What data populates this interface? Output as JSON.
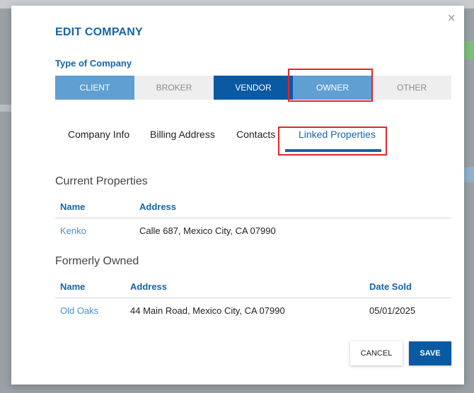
{
  "modal": {
    "title": "EDIT COMPANY",
    "close_glyph": "×"
  },
  "type_of_company": {
    "label": "Type of Company",
    "options": [
      "CLIENT",
      "BROKER",
      "VENDOR",
      "OWNER",
      "OTHER"
    ]
  },
  "tabs": [
    "Company Info",
    "Billing Address",
    "Contacts",
    "Linked Properties"
  ],
  "current_properties": {
    "title": "Current Properties",
    "headers": {
      "name": "Name",
      "address": "Address"
    },
    "rows": [
      {
        "name": "Kenko",
        "address": "Calle 687, Mexico City, CA 07990"
      }
    ]
  },
  "formerly_owned": {
    "title": "Formerly Owned",
    "headers": {
      "name": "Name",
      "address": "Address",
      "date_sold": "Date Sold"
    },
    "rows": [
      {
        "name": "Old Oaks",
        "address": "44 Main Road, Mexico City, CA 07990",
        "date_sold": "05/01/2025"
      }
    ]
  },
  "footer": {
    "cancel_label": "CANCEL",
    "save_label": "SAVE"
  },
  "colors": {
    "primary_blue": "#0a5aa3",
    "light_blue": "#5f9fd2",
    "heading_blue": "#1565a8",
    "highlight_red": "#e0262b"
  }
}
